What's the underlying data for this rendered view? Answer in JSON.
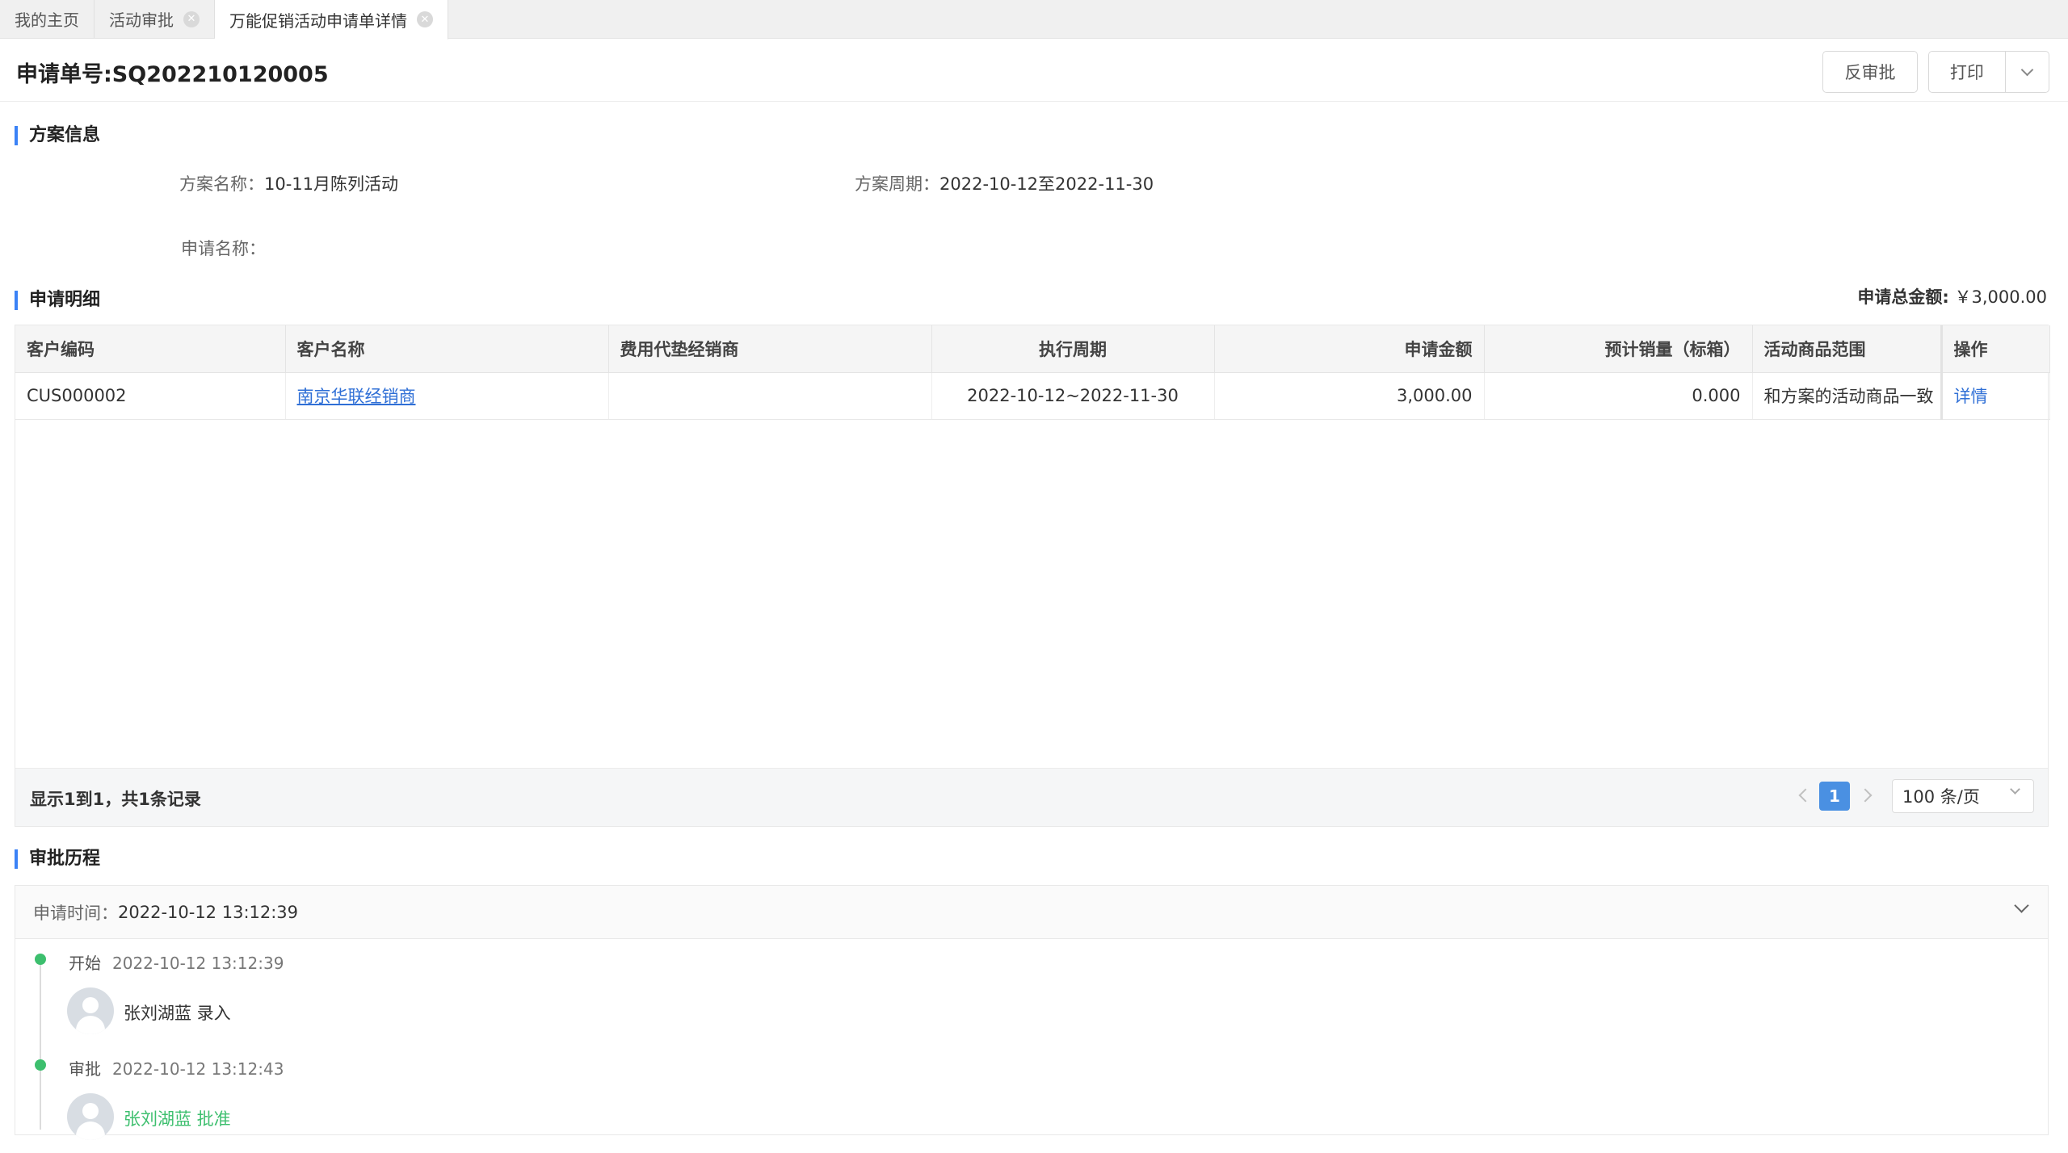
{
  "tabs": [
    {
      "label": "我的主页",
      "closable": false,
      "active": false
    },
    {
      "label": "活动审批",
      "closable": true,
      "active": false
    },
    {
      "label": "万能促销活动申请单详情",
      "closable": true,
      "active": true
    }
  ],
  "header": {
    "title": "申请单号:SQ202210120005",
    "reverse_button": "反审批",
    "print_button": "打印"
  },
  "plan_section": {
    "title": "方案信息",
    "plan_name_label": "方案名称：",
    "plan_name_value": "10-11月陈列活动",
    "plan_period_label": "方案周期：",
    "plan_period_value": "2022-10-12至2022-11-30",
    "apply_name_label": "申请名称：",
    "apply_name_value": ""
  },
  "detail_section": {
    "title": "申请明细",
    "total_label": "申请总金额:",
    "total_value": "￥3,000.00",
    "columns": [
      "客户编码",
      "客户名称",
      "费用代垫经销商",
      "执行周期",
      "申请金额",
      "预计销量（标箱）",
      "活动商品范围",
      "操作"
    ],
    "rows": [
      {
        "customer_code": "CUS000002",
        "customer_name": "南京华联经销商",
        "dealer": "",
        "period": "2022-10-12~2022-11-30",
        "amount": "3,000.00",
        "volume": "0.000",
        "scope": "和方案的活动商品一致",
        "action": "详情"
      }
    ],
    "footer": {
      "record_text": "显示1到1，共1条记录",
      "current_page": "1",
      "page_size": "100 条/页"
    }
  },
  "history_section": {
    "title": "审批历程",
    "apply_time_label": "申请时间：",
    "apply_time_value": "2022-10-12 13:12:39",
    "items": [
      {
        "stage": "开始",
        "time": "2022-10-12 13:12:39",
        "person_action": "张刘湖蓝 录入"
      },
      {
        "stage": "审批",
        "time": "2022-10-12 13:12:43",
        "person_action": "张刘湖蓝 批准"
      }
    ]
  },
  "colors": {
    "accent": "#3b82f6",
    "link": "#2f6fd6",
    "pager_active": "#4a90e2",
    "success": "#3dbf6e"
  }
}
